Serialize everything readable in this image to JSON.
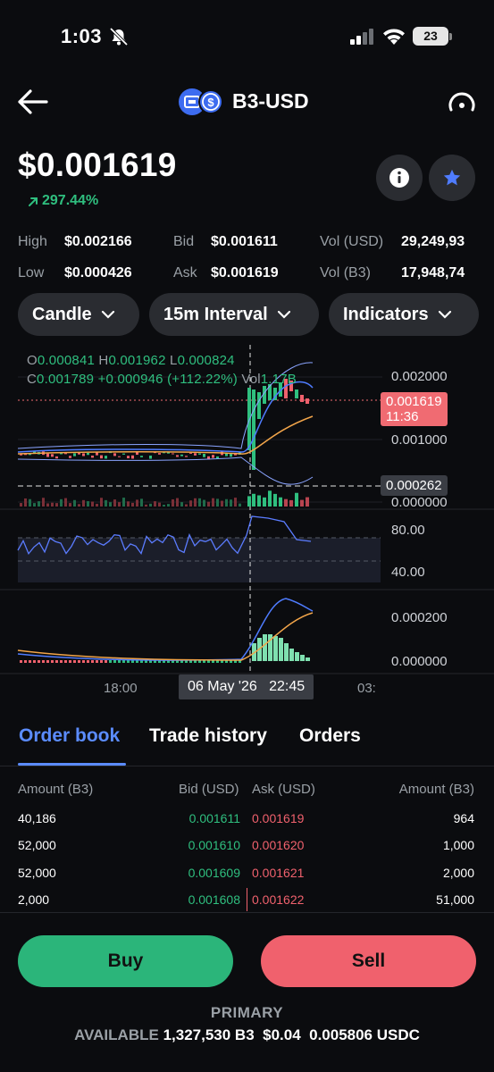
{
  "status_bar": {
    "time": "1:03",
    "battery": "23"
  },
  "header": {
    "pair": "B3-USD"
  },
  "price": {
    "value": "$0.001619",
    "change": "297.44%"
  },
  "stats": {
    "high_label": "High",
    "high_value": "$0.002166",
    "low_label": "Low",
    "low_value": "$0.000426",
    "bid_label": "Bid",
    "bid_value": "$0.001611",
    "ask_label": "Ask",
    "ask_value": "$0.001619",
    "vol_usd_label": "Vol (USD)",
    "vol_usd_value": "29,249,93",
    "vol_b3_label": "Vol (B3)",
    "vol_b3_value": "17,948,74"
  },
  "controls": {
    "chart_type": "Candle",
    "interval": "15m Interval",
    "indicators": "Indicators"
  },
  "chart": {
    "ohlc": {
      "o_label": "O",
      "o_value": "0.000841",
      "h_label": "H",
      "h_value": "0.001962",
      "l_label": "L",
      "l_value": "0.000824",
      "c_label": "C",
      "c_value": "0.001789",
      "change": "+0.000946 (+112.22%)",
      "vol_label": "Vol",
      "vol_value": "1.17B"
    },
    "price_axis": [
      "0.002000",
      "0.001000",
      "0.000000"
    ],
    "last_price": "0.001619",
    "last_countdown": "11:36",
    "crosshair_price": "0.000262",
    "rsi_axis": [
      "80.00",
      "40.00"
    ],
    "macd_axis": [
      "0.000200",
      "0.000000"
    ],
    "time_axis": [
      "18:00",
      "03:"
    ],
    "crosshair_time": "06 May '26   22:45",
    "colors": {
      "up": "#2fbf7f",
      "down": "#f0616d",
      "ma_fast": "#4f7cff",
      "ma_slow": "#f2a54a"
    }
  },
  "tabs": [
    "Order book",
    "Trade history",
    "Orders"
  ],
  "order_book": {
    "headers": [
      "Amount (B3)",
      "Bid (USD)",
      "Ask (USD)",
      "Amount (B3)"
    ],
    "rows": [
      [
        "40,186",
        "0.001611",
        "0.001619",
        "964"
      ],
      [
        "52,000",
        "0.001610",
        "0.001620",
        "1,000"
      ],
      [
        "52,000",
        "0.001609",
        "0.001621",
        "2,000"
      ],
      [
        "2,000",
        "0.001608",
        "0.001622",
        "51,000"
      ]
    ]
  },
  "actions": {
    "buy": "Buy",
    "sell": "Sell"
  },
  "footer": {
    "primary": "PRIMARY",
    "available_label": "AVAILABLE",
    "available_b3": "1,327,530 B3",
    "available_usd": "$0.04",
    "available_usdc": "0.005806 USDC"
  }
}
